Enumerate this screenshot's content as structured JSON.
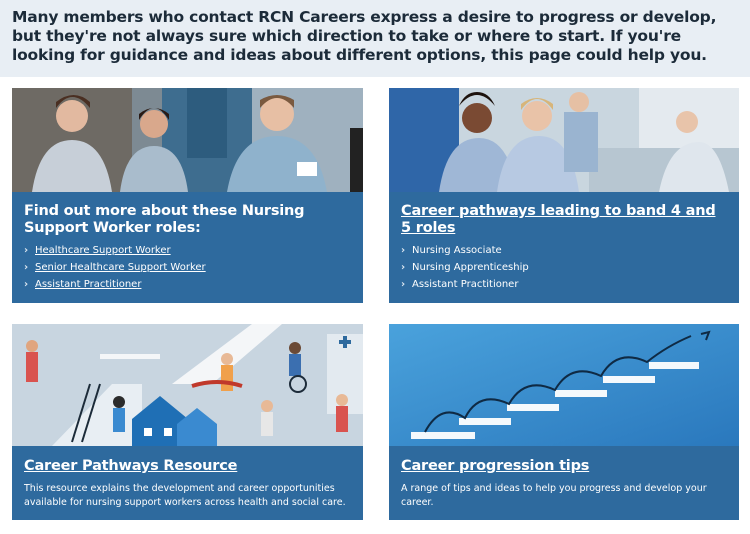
{
  "intro": {
    "text": "Many members who contact RCN Careers express a desire to progress or develop, but they're not always sure which direction to take or where to start. If you're looking for guidance and ideas about different options, this page could help you."
  },
  "cards": [
    {
      "title": "Find out more about these Nursing Support Worker roles:",
      "image": "nurses-smiling-photo",
      "items": [
        {
          "label": "Healthcare Support Worker",
          "icon": "chevron-right-icon"
        },
        {
          "label": "Senior Healthcare Support Worker",
          "icon": "chevron-right-icon"
        },
        {
          "label": "Assistant Practitioner",
          "icon": "chevron-right-icon"
        }
      ]
    },
    {
      "title": "Career pathways leading to band 4 and 5 roles",
      "image": "nurses-at-bedside-photo",
      "items": [
        {
          "label": "Nursing Associate",
          "icon": "chevron-right-icon"
        },
        {
          "label": "Nursing Apprenticeship",
          "icon": "chevron-right-icon"
        },
        {
          "label": "Assistant Practitioner",
          "icon": "chevron-right-icon"
        }
      ]
    },
    {
      "title": "Career Pathways Resource",
      "image": "care-workers-illustration",
      "description": "This resource explains the development and career opportunities available for nursing support workers across health and social care."
    },
    {
      "title": "Career progression tips",
      "image": "ascending-steps-arrow-illustration",
      "description": "A range of tips and ideas to help you  progress and develop your career."
    }
  ],
  "colors": {
    "intro_bg": "#e8eef4",
    "card_bg": "#2e6a9e",
    "text_white": "#ffffff"
  }
}
